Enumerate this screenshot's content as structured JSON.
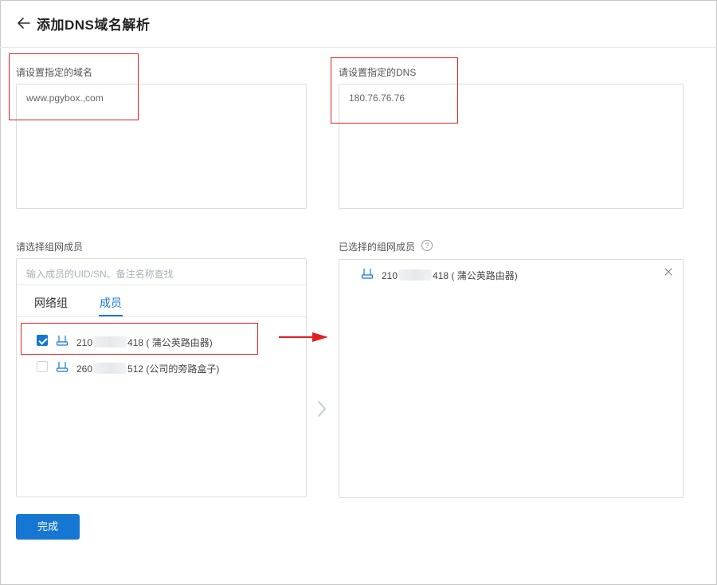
{
  "header": {
    "title": "添加DNS域名解析"
  },
  "domain": {
    "label": "请设置指定的域名",
    "value": "www.pgybox.,com"
  },
  "dns": {
    "label": "请设置指定的DNS",
    "value": "180.76.76.76"
  },
  "members": {
    "label": "请选择组网成员",
    "search_placeholder": "输入成员的UID/SN、备注名称查找",
    "tabs": [
      "网络组",
      "成员"
    ],
    "active_tab": "成员",
    "items": [
      {
        "prefix": "210",
        "suffix": "418 ( 蒲公英路由器)",
        "checked": true
      },
      {
        "prefix": "260",
        "suffix": "512 (公司的旁路盒子)",
        "checked": false
      }
    ]
  },
  "selected": {
    "label": "已选择的组网成员",
    "help_glyph": "?",
    "items": [
      {
        "prefix": "210",
        "suffix": "418 ( 蒲公英路由器)"
      }
    ]
  },
  "actions": {
    "done_label": "完成"
  },
  "colors": {
    "accent": "#1677d2",
    "annotation": "#e02020"
  }
}
